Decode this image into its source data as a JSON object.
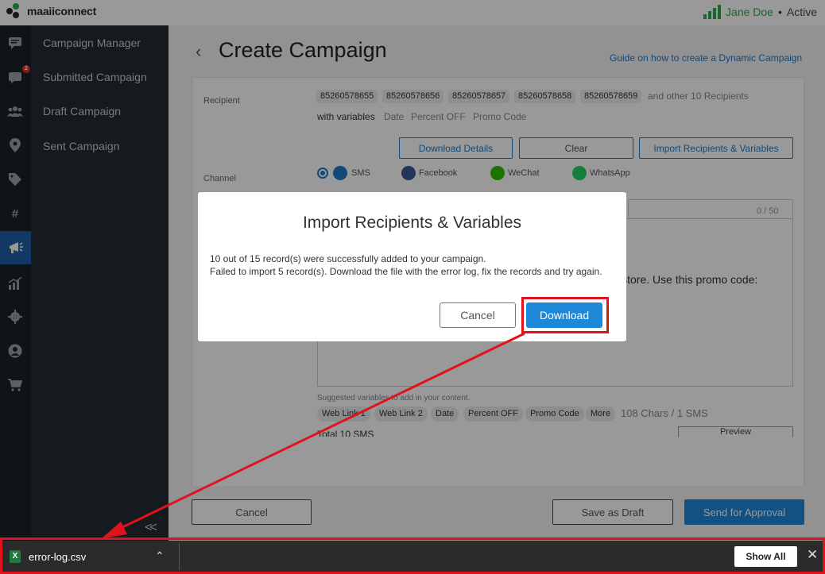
{
  "app": {
    "logo_text": "maaiiconnect"
  },
  "user": {
    "name": "Jane Doe",
    "status": "Active"
  },
  "rail": {
    "icons": [
      "chat-icon",
      "inbox-icon",
      "users-icon",
      "location-icon",
      "tag-icon",
      "hashtag-icon",
      "campaign-icon",
      "chart-icon",
      "settings-icon",
      "profile-icon",
      "cart-icon"
    ],
    "badge": "2",
    "hashtag_glyph": "#"
  },
  "sidebar": {
    "items": [
      {
        "label": "Campaign Manager"
      },
      {
        "label": "Submitted Campaign"
      },
      {
        "label": "Draft Campaign"
      },
      {
        "label": "Sent Campaign"
      }
    ]
  },
  "page": {
    "title": "Create Campaign",
    "guide_link": "Guide on how to create a Dynamic Campaign"
  },
  "form": {
    "recipient_label": "Recipient",
    "recipients": [
      "85260578655",
      "85260578656",
      "85260578657",
      "85260578658",
      "85260578659"
    ],
    "other_recipients": "and other 10 Recipients",
    "with_variables_label": "with variables",
    "variables": [
      "Date",
      "Percent OFF",
      "Promo Code"
    ],
    "download_details": "Download Details",
    "clear": "Clear",
    "import": "Import Recipients & Variables",
    "channel_label": "Channel",
    "channels": [
      "SMS",
      "Facebook",
      "WeChat",
      "WhatsApp"
    ],
    "counter": "0 / 50",
    "message_tail": "our store. Use this promo code:",
    "hint": "Suggested variables to add in your content.",
    "suggested_vars": [
      "Web Link 1",
      "Web Link 2",
      "Date",
      "Percent OFF",
      "Promo Code",
      "More"
    ],
    "char_count": "108 Chars / 1 SMS",
    "total": "Total 10 SMS",
    "preview": "Preview"
  },
  "footer": {
    "cancel": "Cancel",
    "save_draft": "Save as Draft",
    "send": "Send for Approval"
  },
  "modal": {
    "title": "Import Recipients & Variables",
    "line1": "10 out of 15 record(s) were successfully added to your campaign.",
    "line2": "Failed to import 5 record(s). Download the file with the error log, fix the records and try again.",
    "cancel": "Cancel",
    "download": "Download"
  },
  "download_bar": {
    "file_name": "error-log.csv",
    "file_icon_letter": "X",
    "show_all": "Show All"
  },
  "colors": {
    "brand_green": "#2eaa4a",
    "accent_blue": "#1e88d8",
    "annotation_red": "#e0121c"
  }
}
